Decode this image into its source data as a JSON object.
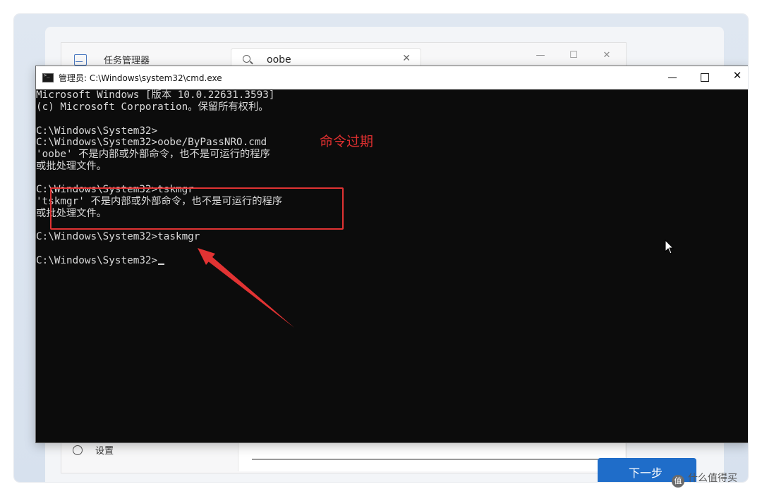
{
  "taskmgr": {
    "title": "任务管理器",
    "search_value": "oobe",
    "settings_label": "设置"
  },
  "oobe": {
    "next_button": "下一步"
  },
  "cmd": {
    "title": "管理员: C:\\Windows\\system32\\cmd.exe",
    "lines": [
      "Microsoft Windows [版本 10.0.22631.3593]",
      "(c) Microsoft Corporation。保留所有权利。",
      "",
      "C:\\Windows\\System32>",
      "C:\\Windows\\System32>oobe/ByPassNRO.cmd",
      "'oobe' 不是内部或外部命令，也不是可运行的程序",
      "或批处理文件。",
      "",
      "C:\\Windows\\System32>tskmgr",
      "'tskmgr' 不是内部或外部命令，也不是可运行的程序",
      "或批处理文件。",
      "",
      "C:\\Windows\\System32>taskmgr",
      "",
      "C:\\Windows\\System32>"
    ]
  },
  "annotation": {
    "label": "命令过期",
    "color": "#e03030"
  },
  "watermark": {
    "text": "什么值得买",
    "badge": "值"
  },
  "icons": [
    "taskmgr-app-icon",
    "search-icon",
    "close-icon",
    "minimize-icon",
    "maximize-icon",
    "gear-icon",
    "cmd-app-icon",
    "mouse-pointer-icon",
    "arrow-annotation"
  ]
}
